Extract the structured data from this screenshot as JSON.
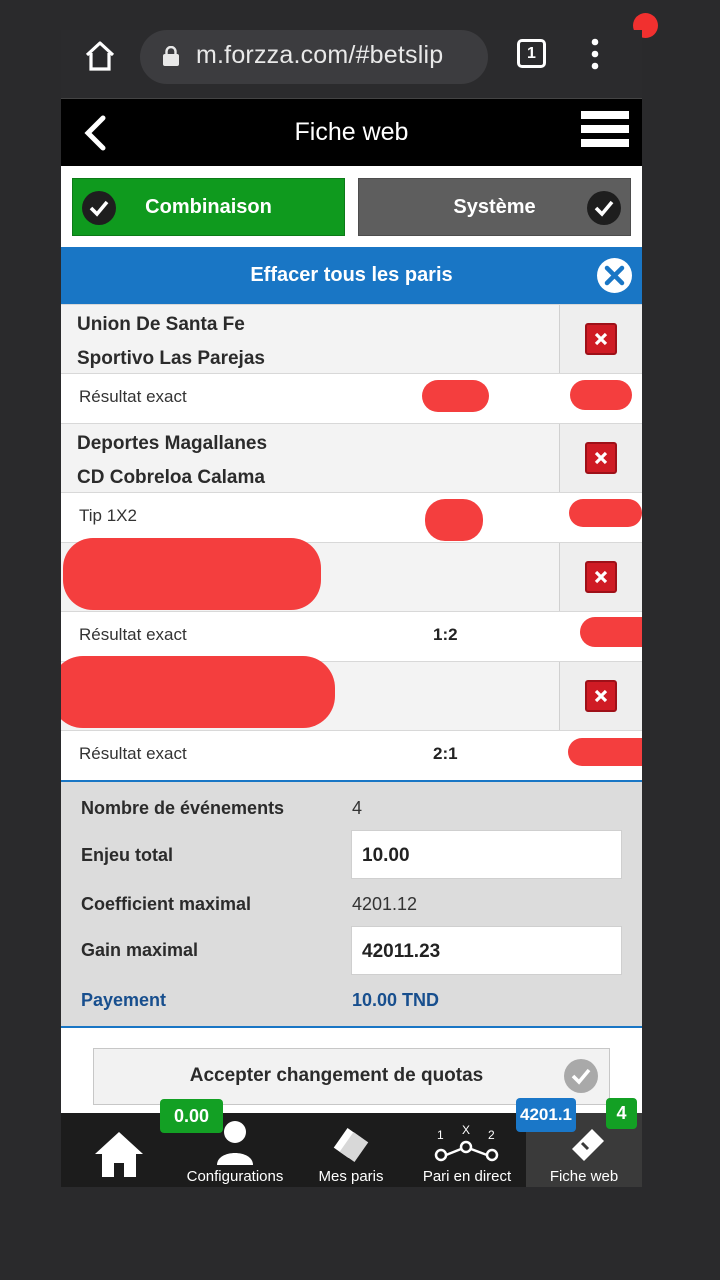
{
  "browser": {
    "url": "m.forzza.com/#betslip",
    "tab_count": "1"
  },
  "header": {
    "title": "Fiche web"
  },
  "modes": {
    "combination": "Combinaison",
    "system": "Système"
  },
  "clear_all": "Effacer tous les paris",
  "bets": [
    {
      "team1": "Union De Santa Fe",
      "team2": "Sportivo Las Parejas",
      "type": "Résultat exact",
      "score": ""
    },
    {
      "team1": "Deportes Magallanes",
      "team2": "CD Cobreloa Calama",
      "type": "Tip 1X2",
      "score": ""
    },
    {
      "team1": "",
      "team2": "",
      "type": "Résultat exact",
      "score": "1:2"
    },
    {
      "team1": "",
      "team2": "",
      "type": "Résultat exact",
      "score": "2:1"
    }
  ],
  "summary": {
    "events_label": "Nombre de événements",
    "events_value": "4",
    "stake_label": "Enjeu total",
    "stake_value": "10.00",
    "max_coef_label": "Coefficient maximal",
    "max_coef_value": "4201.12",
    "max_gain_label": "Gain maximal",
    "max_gain_value": "42011.23",
    "payment_label": "Payement",
    "payment_value": "10.00 TND"
  },
  "accept_label": "Accepter changement de quotas",
  "bottom_nav": {
    "balance_badge": "0.00",
    "coef_badge": "4201.1",
    "count_badge": "4",
    "items": [
      "",
      "Configurations",
      "Mes paris",
      "Pari en direct",
      "Fiche web"
    ]
  },
  "colors": {
    "green": "#0f9a1e",
    "blue": "#1976c5",
    "delete": "#cf1b24",
    "redaction": "#f43e3e"
  }
}
